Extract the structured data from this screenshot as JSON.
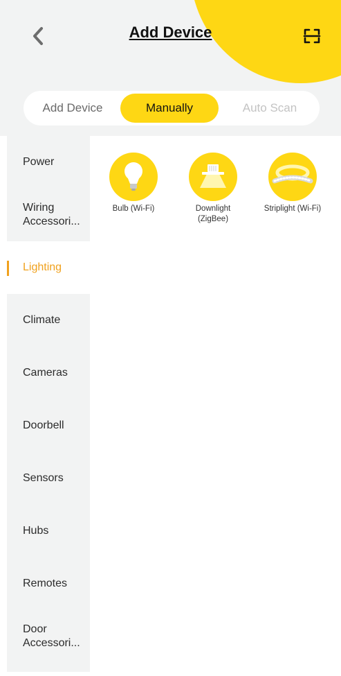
{
  "header": {
    "title": "Add Device",
    "back_icon": "chevron-left-icon",
    "scan_icon": "scan-frame-icon",
    "accent_color": "#fed714"
  },
  "segments": [
    {
      "label": "Add Device",
      "selected": false
    },
    {
      "label": "Manually",
      "selected": true
    },
    {
      "label": "Auto Scan",
      "selected": false
    }
  ],
  "sidebar": {
    "active_color": "#f0a11d",
    "items": [
      {
        "label": "Power",
        "active": false
      },
      {
        "label": "Wiring Accessori...",
        "active": false
      },
      {
        "label": "Lighting",
        "active": true
      },
      {
        "label": "Climate",
        "active": false
      },
      {
        "label": "Cameras",
        "active": false
      },
      {
        "label": "Doorbell",
        "active": false
      },
      {
        "label": "Sensors",
        "active": false
      },
      {
        "label": "Hubs",
        "active": false
      },
      {
        "label": "Remotes",
        "active": false
      },
      {
        "label": "Door Accessori...",
        "active": false
      }
    ]
  },
  "devices": [
    {
      "label": "Bulb (Wi-Fi)",
      "icon": "bulb-icon"
    },
    {
      "label": "Downlight (ZigBee)",
      "icon": "downlight-icon"
    },
    {
      "label": "Striplight (Wi-Fi)",
      "icon": "striplight-icon"
    }
  ]
}
